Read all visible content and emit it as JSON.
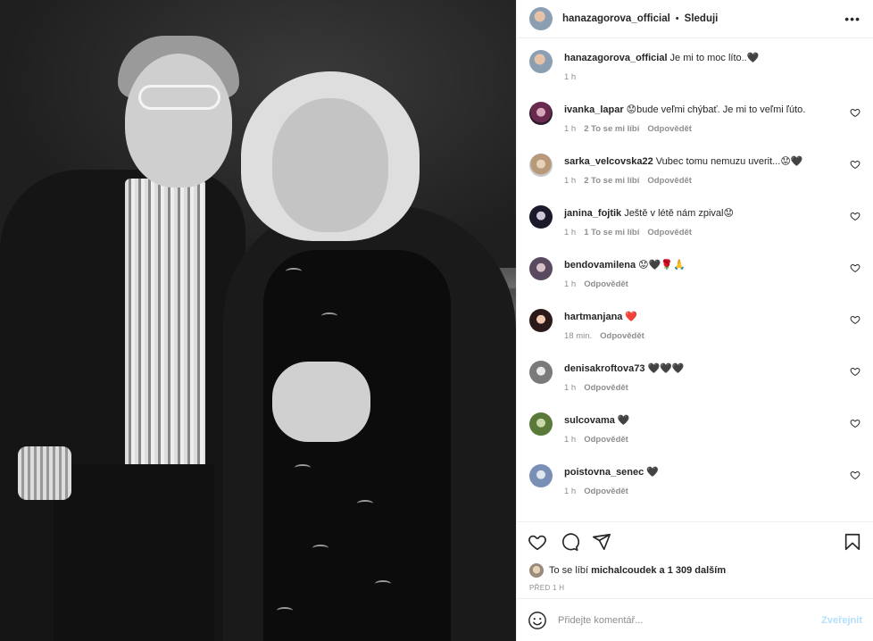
{
  "post": {
    "author": "hanazagorova_official",
    "separator": "•",
    "follow_label": "Sleduji",
    "more_icon": "more-horizontal-icon"
  },
  "caption": {
    "username": "hanazagorova_official",
    "text": "Je mi to moc líto..🖤",
    "time": "1 h"
  },
  "comments": [
    {
      "username": "ivanka_lapar",
      "text": "😟bude veľmi chýbať. Je mi to veľmi ľúto.",
      "time": "1 h",
      "likes": "2 To se mi líbí",
      "reply": "Odpovědět"
    },
    {
      "username": "sarka_velcovska22",
      "text": "Vubec tomu nemuzu uverit...😟🖤",
      "time": "1 h",
      "likes": "2 To se mi líbí",
      "reply": "Odpovědět"
    },
    {
      "username": "janina_fojtik",
      "text": "Ještě v létě nám zpival😟",
      "time": "1 h",
      "likes": "1 To se mi líbí",
      "reply": "Odpovědět"
    },
    {
      "username": "bendovamilena",
      "text": "😟🖤🌹🙏",
      "time": "1 h",
      "likes": "",
      "reply": "Odpovědět"
    },
    {
      "username": "hartmanjana",
      "text": "❤️",
      "time": "18 min.",
      "likes": "",
      "reply": "Odpovědět"
    },
    {
      "username": "denisakroftova73",
      "text": "🖤🖤🖤",
      "time": "1 h",
      "likes": "",
      "reply": "Odpovědět"
    },
    {
      "username": "sulcovama",
      "text": "🖤",
      "time": "1 h",
      "likes": "",
      "reply": "Odpovědět"
    },
    {
      "username": "poistovna_senec",
      "text": "🖤",
      "time": "1 h",
      "likes": "",
      "reply": "Odpovědět"
    }
  ],
  "likes_line": {
    "prefix": "To se líbí",
    "user": "michalcoudek",
    "suffix": "a 1 309 dalším"
  },
  "posted_time": "PŘED 1 H",
  "add_comment": {
    "placeholder": "Přidejte komentář...",
    "post_label": "Zveřejnit"
  },
  "colors": {
    "text": "#262626",
    "secondary": "#8e8e8e",
    "border": "#efefef",
    "post_disabled": "#b2dffc"
  }
}
